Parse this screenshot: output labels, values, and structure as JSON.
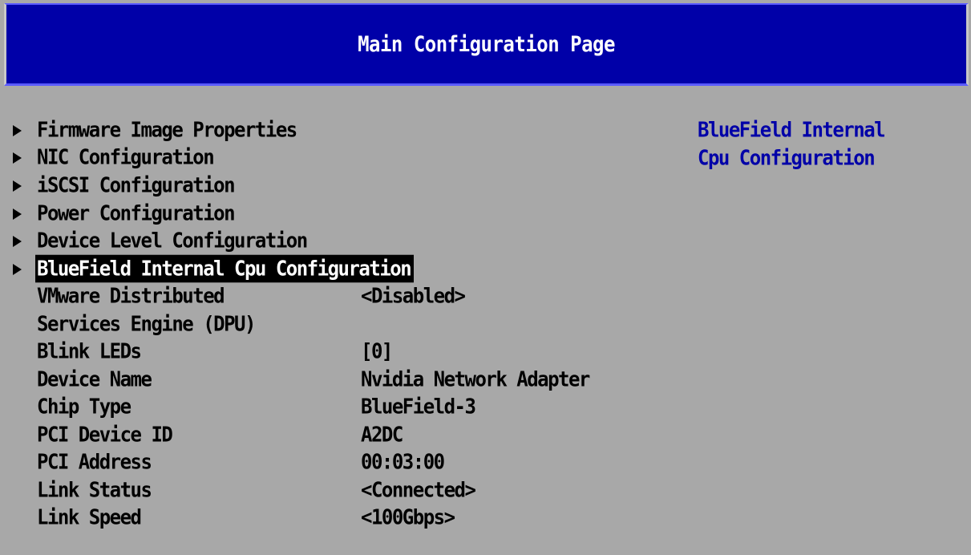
{
  "header": {
    "title": "Main Configuration Page"
  },
  "menu": {
    "submenus": [
      {
        "label": "Firmware Image Properties"
      },
      {
        "label": "NIC Configuration"
      },
      {
        "label": "iSCSI Configuration"
      },
      {
        "label": "Power Configuration"
      },
      {
        "label": "Device Level Configuration"
      },
      {
        "label": "BlueField Internal Cpu Configuration",
        "selected": true
      }
    ],
    "settings": [
      {
        "label": "VMware Distributed",
        "value": "<Disabled>"
      },
      {
        "label": "Services Engine (DPU)",
        "value": ""
      },
      {
        "label": "Blink LEDs",
        "value": "[0]"
      },
      {
        "label": "Device Name",
        "value": "Nvidia Network Adapter"
      },
      {
        "label": "Chip Type",
        "value": "BlueField-3"
      },
      {
        "label": "PCI Device ID",
        "value": "A2DC"
      },
      {
        "label": "PCI Address",
        "value": "00:03:00"
      },
      {
        "label": "Link Status",
        "value": "<Connected>"
      },
      {
        "label": "Link Speed",
        "value": "<100Gbps>"
      }
    ]
  },
  "help": {
    "line1": "BlueField Internal",
    "line2": "Cpu Configuration"
  },
  "colors": {
    "background": "#a8a8a8",
    "header_bg": "#0000a8",
    "help_text": "#0000a8",
    "selection_bg": "#000000",
    "selection_fg": "#ffffff"
  }
}
